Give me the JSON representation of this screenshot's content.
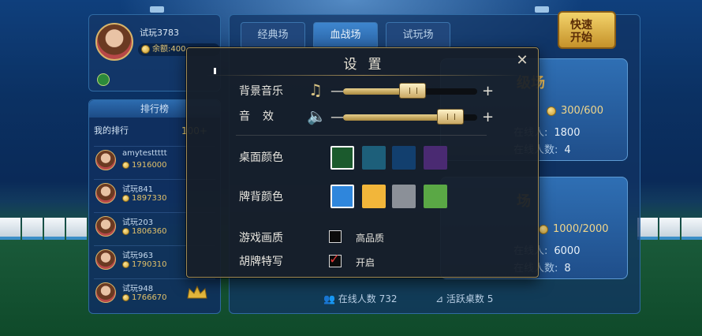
{
  "profile": {
    "name": "试玩3783",
    "balance": "余额:400"
  },
  "rank": {
    "title": "排行榜",
    "mine_label": "我的排行",
    "mine_value": "100+",
    "rows": [
      {
        "name": "amytesttttt",
        "score": "1916000"
      },
      {
        "name": "试玩841",
        "score": "1897330"
      },
      {
        "name": "试玩203",
        "score": "1806360"
      },
      {
        "name": "试玩963",
        "score": "1790310"
      },
      {
        "name": "试玩948",
        "score": "1766670"
      }
    ]
  },
  "tabs": [
    "经典场",
    "血战场",
    "试玩场"
  ],
  "active_tab": "血战场",
  "quick_start": {
    "line1": "快速",
    "line2": "开始"
  },
  "rooms": [
    {
      "title": "级场",
      "bet": "300/600",
      "players_label": "在线人:",
      "players": "1800",
      "tables_label": "在线人数:",
      "tables": "4"
    },
    {
      "title": "场",
      "bet": "1000/2000",
      "players_label": "在线人:",
      "players": "6000",
      "tables_label": "在线人数:",
      "tables": "8"
    }
  ],
  "stats": {
    "online_label": "在线人数",
    "online": "732",
    "tables_label": "活跃桌数",
    "tables": "5"
  },
  "settings": {
    "title": "设置",
    "music_label": "背景音乐",
    "music_level": 0.52,
    "effect_label": "音效",
    "effect_level": 0.8,
    "table_color_label": "桌面颜色",
    "table_colors": [
      "#1b5a2d",
      "#1d5f7a",
      "#123f6e",
      "#4a2a72"
    ],
    "table_selected": 0,
    "back_color_label": "牌背颜色",
    "back_colors": [
      "#2f86dc",
      "#f2b63a",
      "#8b9098",
      "#5aa845"
    ],
    "back_selected": 0,
    "quality_label": "游戏画质",
    "quality_option": "高品质",
    "quality_checked": false,
    "closeup_label": "胡牌特写",
    "closeup_option": "开启",
    "closeup_checked": true,
    "music_icon": "music-note-icon",
    "effect_icon": "speaker-icon",
    "minus": "—",
    "plus": "+"
  }
}
